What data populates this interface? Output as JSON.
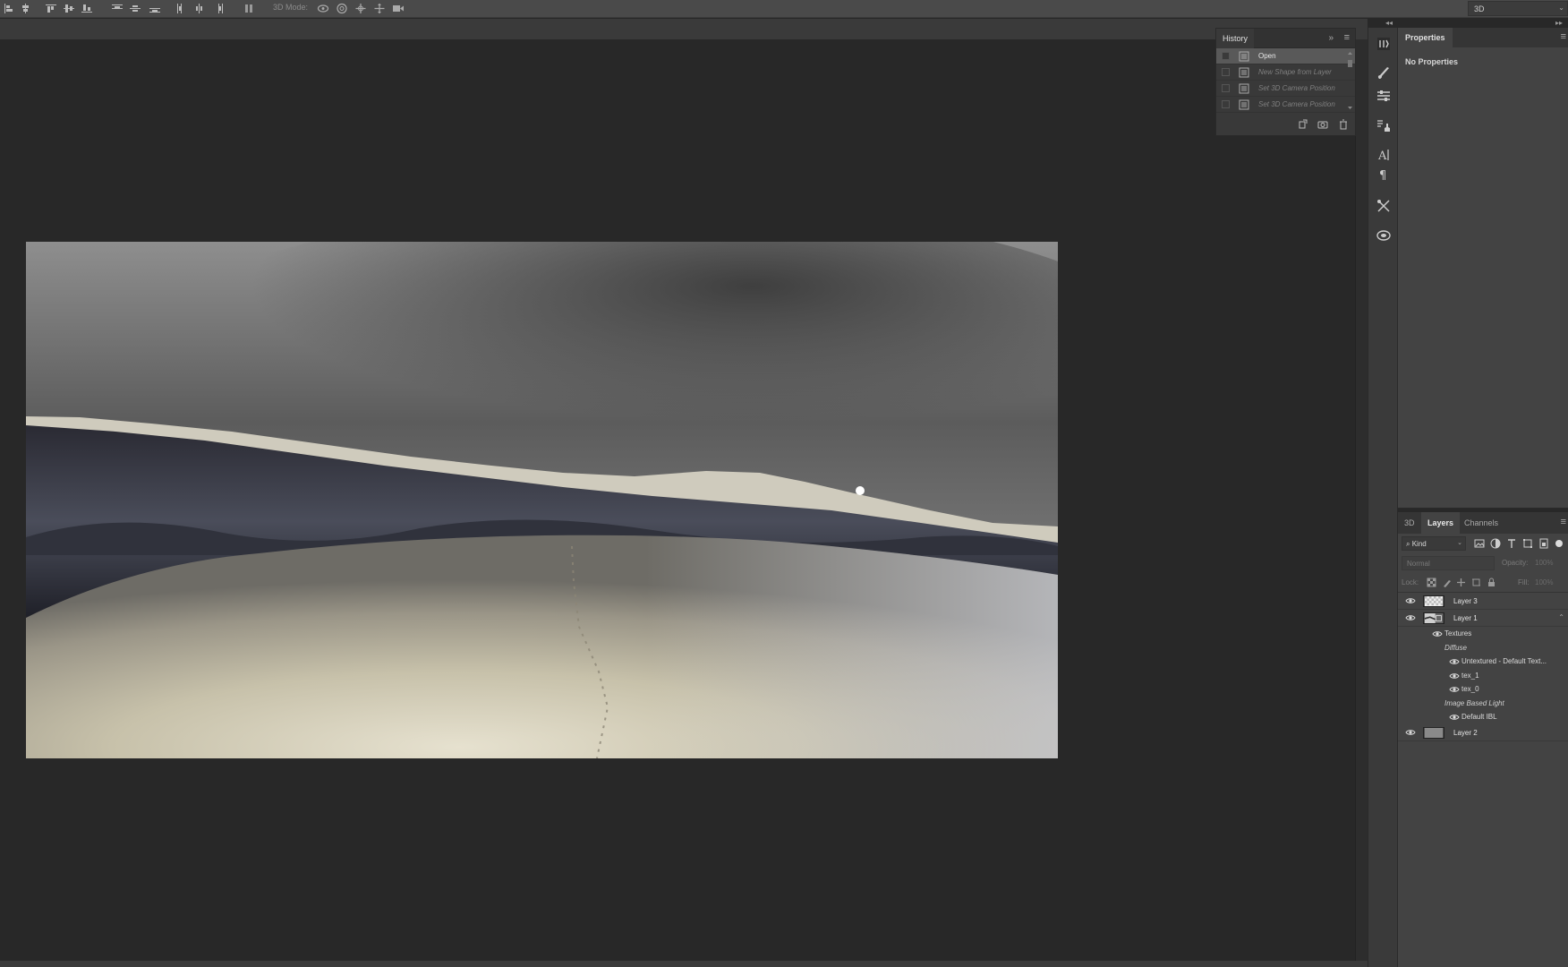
{
  "options_bar": {
    "mode_label": "3D Mode:",
    "icons": [
      "align-left-edges-icon",
      "align-horizontal-centers-icon",
      "align-right-edges-icon",
      "align-top-edges-icon",
      "align-vertical-centers-icon",
      "align-bottom-edges-icon",
      "distribute-top-icon",
      "distribute-vertical-icon",
      "distribute-bottom-icon",
      "distribute-left-icon",
      "distribute-horizontal-icon",
      "distribute-right-icon",
      "auto-align-icon",
      "orbit-3d-icon",
      "roll-3d-icon",
      "pan-3d-icon",
      "slide-3d-icon",
      "scale-3d-icon"
    ]
  },
  "workspace": {
    "selected": "3D"
  },
  "history": {
    "tab": "History",
    "items": [
      {
        "label": "Open",
        "selected": true
      },
      {
        "label": "New Shape from Layer",
        "selected": false
      },
      {
        "label": "Set 3D Camera Position",
        "selected": false
      },
      {
        "label": "Set 3D Camera Position",
        "selected": false
      }
    ],
    "footer_icons": [
      "new-document-from-state-icon",
      "snapshot-camera-icon",
      "trash-icon"
    ]
  },
  "strip_icons": [
    "history-icon",
    "brush-settings-icon",
    "adjustments-icon",
    "clone-source-icon",
    "character-icon",
    "paragraph-icon",
    "tool-presets-icon",
    "libraries-icon"
  ],
  "properties": {
    "tab": "Properties",
    "empty_text": "No Properties"
  },
  "layers_panel": {
    "tabs": [
      {
        "label": "3D",
        "active": false
      },
      {
        "label": "Layers",
        "active": true
      },
      {
        "label": "Channels",
        "active": false
      }
    ],
    "kind_filter": "Kind",
    "blend_mode": "Normal",
    "opacity_label": "Opacity:",
    "opacity_value": "100%",
    "lock_label": "Lock:",
    "fill_label": "Fill:",
    "fill_value": "100%",
    "layers": [
      {
        "name": "Layer 3"
      },
      {
        "name": "Layer 1"
      }
    ],
    "sublayers": [
      {
        "name": "Textures",
        "eye": true,
        "italic": false
      },
      {
        "name": "Diffuse",
        "eye": false,
        "italic": true
      },
      {
        "name": "Untextured - Default Text...",
        "eye": true,
        "italic": false
      },
      {
        "name": "tex_1",
        "eye": true,
        "italic": false
      },
      {
        "name": "tex_0",
        "eye": true,
        "italic": false
      },
      {
        "name": "Image Based Light",
        "eye": false,
        "italic": true
      },
      {
        "name": "Default IBL",
        "eye": true,
        "italic": false
      }
    ],
    "bottom_layer": {
      "name": "Layer 2"
    }
  },
  "colors": {
    "workspace_bg": "#282828",
    "panel_bg": "#434343",
    "selected_row": "#595959"
  }
}
